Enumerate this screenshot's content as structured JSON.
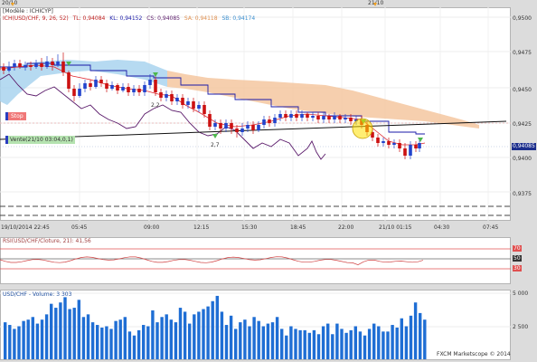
{
  "top_dates": [
    "20/10",
    "21/10"
  ],
  "header": {
    "model": "[Modèle : ICHICYP]",
    "ichimoku": {
      "name": "ICH(USD/CHF, 9, 26, 52)",
      "tl": "TL: 0,94084",
      "kl": "KL: 0,94152",
      "cs": "CS: 0,94085",
      "sa": "SA: 0,94118",
      "sb": "SB: 0,94174"
    }
  },
  "badges": {
    "stop": "Stop",
    "vente": "Vente(21/10 03:04,0,1)"
  },
  "signals": {
    "a": "2,2",
    "b": "2,7"
  },
  "price_axis": [
    "0,9500",
    "0,9475",
    "0,9450",
    "0,9425",
    "0,9400",
    "0,9375"
  ],
  "current_price": "0,94085",
  "time_axis": [
    "19/10/2014 22:45",
    "05:45",
    "09:00",
    "12:15",
    "15:30",
    "18:45",
    "22:00",
    "21/10 01:15",
    "04:30",
    "07:45"
  ],
  "rsi": {
    "label": "RSI(USD/CHF/Cloture, 21): 41,56",
    "levels": [
      "70",
      "50",
      "30"
    ]
  },
  "volume": {
    "label": "USD/CHF - Volume: 3 303",
    "axis": [
      "5 000",
      "2 500"
    ],
    "bars": [
      2800,
      2600,
      2300,
      2500,
      2900,
      3000,
      3200,
      2700,
      3000,
      3400,
      4200,
      3900,
      4300,
      4700,
      3800,
      3900,
      4500,
      3200,
      3400,
      2800,
      2600,
      2400,
      2500,
      2300,
      2900,
      3000,
      3200,
      2100,
      1800,
      2200,
      2600,
      2500,
      3700,
      2800,
      3200,
      3400,
      3000,
      2800,
      3900,
      3600,
      2700,
      3400,
      3600,
      3800,
      4000,
      4400,
      4800,
      3600,
      2600,
      3300,
      2300,
      2800,
      3000,
      2500,
      3200,
      2900,
      2500,
      2700,
      2800,
      3200,
      2300,
      1800,
      2500,
      2300,
      2200,
      2200,
      2000,
      2200,
      1900,
      2500,
      2700,
      1900,
      2700,
      2300,
      2000,
      2200,
      2500,
      2100,
      1800,
      2300,
      2700,
      2500,
      2100,
      2100,
      2600,
      2400,
      3100,
      2500,
      3300,
      4300,
      3500,
      3000
    ]
  },
  "copyright": "FXCM Marketscope © 2014",
  "colors": {
    "up": "#2244cc",
    "down": "#cc1111",
    "tenkan": "#e0262e",
    "kijun": "#1a1aa8",
    "chikou": "#5a1a6a",
    "cloud_bull": "#a9d3ee",
    "cloud_bear": "#f5c7a0",
    "volume": "#1f6ed4"
  }
}
